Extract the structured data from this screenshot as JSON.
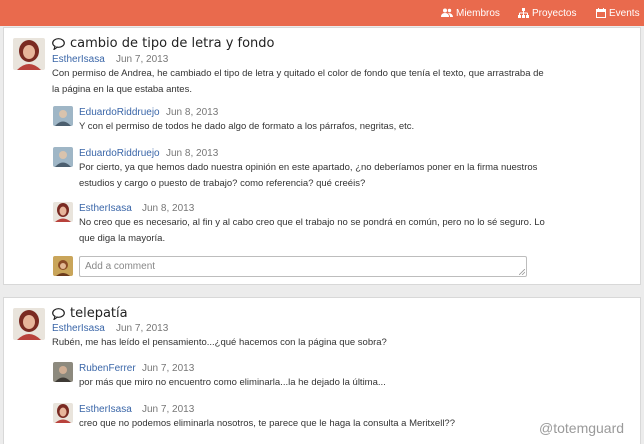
{
  "nav": {
    "miembros": "Miembros",
    "proyectos": "Proyectos",
    "events": "Events",
    "miembros_icon": "users-icon",
    "proyectos_icon": "sitemap-icon",
    "events_icon": "calendar-icon"
  },
  "colors": {
    "topbar": "#e96a4d",
    "link": "#3a66a8"
  },
  "topic1": {
    "title": "cambio de tipo de letra y fondo",
    "author": "EstherIsasa",
    "date": "Jun 7, 2013",
    "body": "Con permiso de Andrea, he cambiado el tipo de letra y quitado el color de fondo que tenía el texto, que arrastraba de la página en la que estaba antes.",
    "replies": [
      {
        "author": "EduardoRiddruejo",
        "date": "Jun 8, 2013",
        "body": "Y con el permiso de todos he dado algo de formato a los párrafos, negritas, etc."
      },
      {
        "author": "EduardoRiddruejo",
        "date": "Jun 8, 2013",
        "body": "Por cierto, ya que hemos dado nuestra opinión en este apartado, ¿no deberíamos poner en la firma nuestros estudios y cargo o puesto de trabajo? como referencia? qué creéis?"
      },
      {
        "author": "EstherIsasa",
        "date": "Jun 8, 2013",
        "body": "No creo que es necesario, al fin y al cabo creo que el trabajo no se pondrá en común, pero no lo sé seguro. Lo que diga la mayoría."
      }
    ],
    "comment_placeholder": "Add a comment"
  },
  "topic2": {
    "title": "telepatía",
    "author": "EstherIsasa",
    "date": "Jun 7, 2013",
    "body": "Rubén, me has leído el pensamiento...¿qué hacemos con la página que sobra?",
    "replies": [
      {
        "author": "RubenFerrer",
        "date": "Jun 7, 2013",
        "body": "por más que miro no encuentro como eliminarla...la he dejado la última..."
      },
      {
        "author": "EstherIsasa",
        "date": "Jun 7, 2013",
        "body": "creo que no podemos eliminarla nosotros, te parece que le haga la consulta a Meritxell??"
      }
    ]
  },
  "watermark": "@totemguard"
}
